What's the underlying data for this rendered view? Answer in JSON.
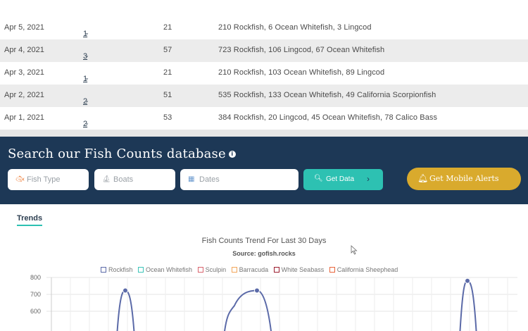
{
  "table": {
    "rows": [
      {
        "date": "Apr 5, 2021",
        "boats": "1",
        "anglers": "21",
        "fish": "210 Rockfish,  6 Ocean Whitefish,  3 Lingcod"
      },
      {
        "date": "Apr 4, 2021",
        "boats": "3",
        "anglers": "57",
        "fish": "723 Rockfish,  106 Lingcod,  67 Ocean Whitefish"
      },
      {
        "date": "Apr 3, 2021",
        "boats": "1",
        "anglers": "21",
        "fish": "210 Rockfish,  103 Ocean Whitefish,  89 Lingcod"
      },
      {
        "date": "Apr 2, 2021",
        "boats": "2",
        "anglers": "51",
        "fish": "535 Rockfish,  133 Ocean Whitefish,  49 California Scorpionfish"
      },
      {
        "date": "Apr 1, 2021",
        "boats": "2",
        "anglers": "53",
        "fish": "384 Rockfish,  20 Lingcod,  45 Ocean Whitefish,  78 Calico Bass"
      }
    ]
  },
  "search": {
    "title": "Search our Fish Counts database",
    "info_icon": "info-icon",
    "fish_type_placeholder": "Fish Type",
    "boats_placeholder": "Boats",
    "dates_placeholder": "Dates",
    "get_data_label": "Get Data",
    "alerts_label": "Get Mobile Alerts",
    "colors": {
      "background": "#1d3856",
      "get_data": "#2dc1b2",
      "alerts": "#d9aa2d"
    }
  },
  "trends": {
    "tab_label": "Trends"
  },
  "chart_data": {
    "type": "line",
    "title": "Fish Counts Trend For Last 30 Days",
    "subtitle": "Source: gofish.rocks",
    "legend_placement": "top",
    "series": [
      {
        "name": "Rockfish",
        "color": "#5b6aa8"
      },
      {
        "name": "Ocean Whitefish",
        "color": "#3cc3b8"
      },
      {
        "name": "Sculpin",
        "color": "#d9646e"
      },
      {
        "name": "Barracuda",
        "color": "#f2a65a"
      },
      {
        "name": "White Seabass",
        "color": "#9b1c2e"
      },
      {
        "name": "California Sheephead",
        "color": "#e8643a"
      }
    ],
    "yticks": [
      "800",
      "700"
    ],
    "ylim": [
      600,
      800
    ],
    "grid": true,
    "rockfish_visible_points": [
      {
        "x": 1,
        "y": 723
      },
      {
        "x": 2,
        "y": 600
      },
      {
        "x": 3,
        "y": 723
      },
      {
        "x": 4,
        "y": 780
      }
    ]
  }
}
